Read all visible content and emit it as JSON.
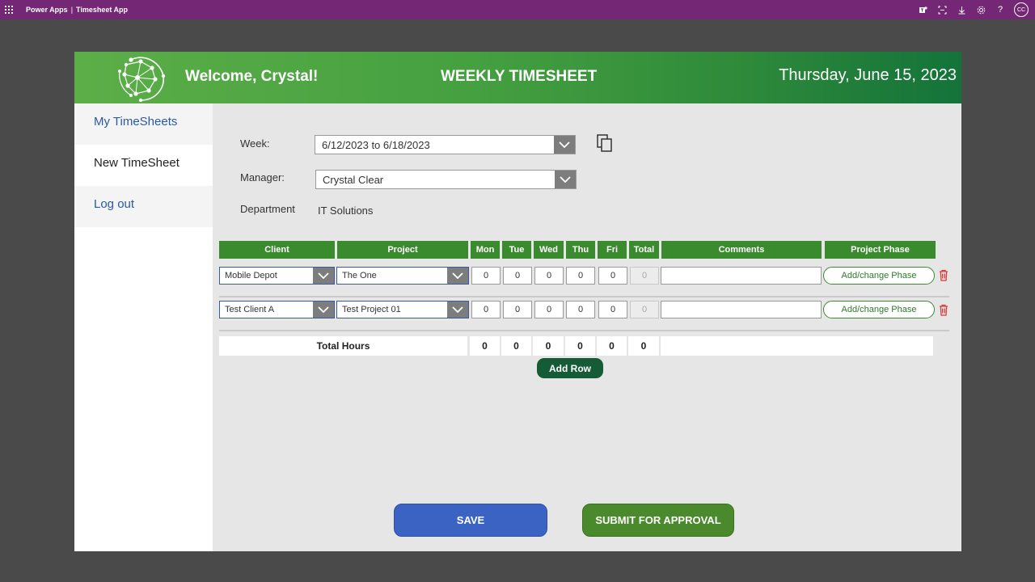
{
  "topbar": {
    "brand": "Power Apps",
    "separator": "|",
    "app_name": "Timesheet App",
    "avatar_initials": "CC",
    "icons": [
      "waffle-icon",
      "teams-icon",
      "fit-screen-icon",
      "download-icon",
      "settings-icon",
      "help-icon"
    ]
  },
  "header": {
    "welcome": "Welcome, Crystal!",
    "title": "WEEKLY TIMESHEET",
    "date": "Thursday, June 15, 2023",
    "gradient": [
      "#5cae48",
      "#13733a"
    ]
  },
  "sidebar": {
    "items": [
      {
        "label": "My TimeSheets",
        "active": false
      },
      {
        "label": "New TimeSheet",
        "active": true
      },
      {
        "label": "Log out",
        "active": false
      }
    ]
  },
  "form": {
    "week_label": "Week:",
    "week_value": "6/12/2023 to 6/18/2023",
    "manager_label": "Manager:",
    "manager_value": "Crystal Clear",
    "department_label": "Department",
    "department_value": "IT Solutions"
  },
  "grid": {
    "headers": [
      "Client",
      "Project",
      "Mon",
      "Tue",
      "Wed",
      "Thu",
      "Fri",
      "Total",
      "Comments",
      "Project Phase"
    ],
    "rows": [
      {
        "client": "Mobile Depot",
        "project": "The One",
        "hours": [
          "0",
          "0",
          "0",
          "0",
          "0"
        ],
        "total": "0",
        "comment": "",
        "phase_label": "Add/change Phase"
      },
      {
        "client": "Test Client A",
        "project": "Test Project 01",
        "hours": [
          "0",
          "0",
          "0",
          "0",
          "0"
        ],
        "total": "0",
        "comment": "",
        "phase_label": "Add/change Phase"
      }
    ],
    "totals_label": "Total Hours",
    "totals": [
      "0",
      "0",
      "0",
      "0",
      "0",
      "0"
    ]
  },
  "actions": {
    "add_row": "Add Row",
    "save": "SAVE",
    "submit": "SUBMIT FOR APPROVAL"
  },
  "colors": {
    "topbar": "#742774",
    "header_green": "#3a8a2e",
    "add_row": "#155c36",
    "save": "#3a63c4",
    "submit": "#4a8a2c",
    "nav_link": "#2a5aa0",
    "delete": "#d83b3b"
  }
}
